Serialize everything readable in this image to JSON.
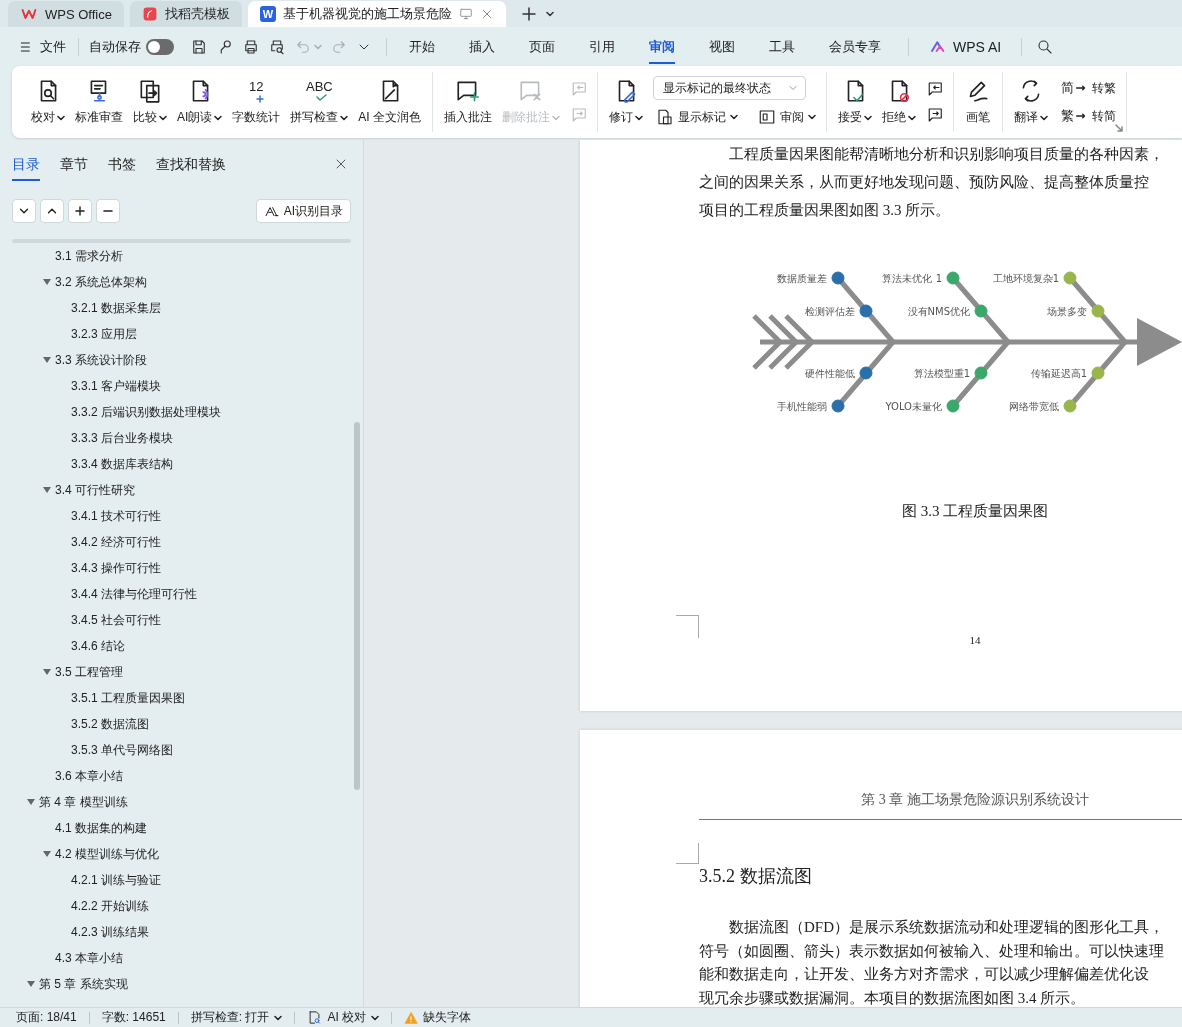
{
  "window_tabs": [
    {
      "kind": "home",
      "label": "WPS Office",
      "selected": false
    },
    {
      "kind": "template",
      "label": "找稻壳模板",
      "selected": false
    },
    {
      "kind": "document",
      "badge": "W",
      "label": "基于机器视觉的施工场景危险",
      "selected": true
    }
  ],
  "menu": {
    "file": "文件",
    "autosave": {
      "label": "自动保存",
      "on": false
    },
    "tabs": [
      {
        "label": "开始",
        "selected": false
      },
      {
        "label": "插入",
        "selected": false
      },
      {
        "label": "页面",
        "selected": false
      },
      {
        "label": "引用",
        "selected": false
      },
      {
        "label": "审阅",
        "selected": true
      },
      {
        "label": "视图",
        "selected": false
      },
      {
        "label": "工具",
        "selected": false
      },
      {
        "label": "会员专享",
        "selected": false
      }
    ],
    "ai": "WPS AI"
  },
  "ribbon": {
    "groups": [
      {
        "items": [
          {
            "kind": "large",
            "label": "校对",
            "dropdown": true,
            "disabled": false
          },
          {
            "kind": "large",
            "label": "标准审查",
            "dropdown": false,
            "disabled": false
          },
          {
            "kind": "large",
            "label": "比较",
            "dropdown": true,
            "disabled": false
          },
          {
            "kind": "large",
            "label": "AI朗读",
            "dropdown": true,
            "disabled": false
          },
          {
            "kind": "large",
            "glyph": "12",
            "label": "字数统计",
            "dropdown": false,
            "disabled": false
          },
          {
            "kind": "large",
            "glyph": "ABC",
            "label": "拼写检查",
            "dropdown": true,
            "disabled": false
          },
          {
            "kind": "large",
            "label": "AI 全文润色",
            "dropdown": false,
            "disabled": false
          }
        ]
      },
      {
        "items": [
          {
            "kind": "large",
            "label": "插入批注",
            "dropdown": false,
            "disabled": false
          },
          {
            "kind": "large",
            "label": "删除批注",
            "dropdown": true,
            "disabled": true
          },
          {
            "kind": "stack",
            "items": [
              {
                "kind": "icon",
                "disabled": true
              },
              {
                "kind": "icon",
                "disabled": true
              }
            ]
          }
        ]
      },
      {
        "items": [
          {
            "kind": "large",
            "label": "修订",
            "dropdown": true,
            "disabled": false
          },
          {
            "kind": "stack",
            "items": [
              {
                "kind": "select",
                "value": "显示标记的最终状态"
              },
              {
                "kind": "row",
                "items": [
                  {
                    "kind": "small",
                    "label": "显示标记",
                    "dropdown": true,
                    "disabled": false
                  },
                  {
                    "kind": "small",
                    "label": "审阅",
                    "dropdown": true,
                    "disabled": false
                  }
                ]
              }
            ]
          }
        ]
      },
      {
        "items": [
          {
            "kind": "large",
            "label": "接受",
            "dropdown": true,
            "disabled": false
          },
          {
            "kind": "large",
            "label": "拒绝",
            "dropdown": true,
            "disabled": false
          },
          {
            "kind": "stack",
            "items": [
              {
                "kind": "icon",
                "disabled": false
              },
              {
                "kind": "icon",
                "disabled": false
              }
            ]
          }
        ]
      },
      {
        "items": [
          {
            "kind": "large",
            "label": "画笔",
            "dropdown": false,
            "disabled": false
          }
        ]
      },
      {
        "items": [
          {
            "kind": "large",
            "label": "翻译",
            "dropdown": true,
            "disabled": false
          },
          {
            "kind": "stack",
            "items": [
              {
                "kind": "small",
                "glyph": "简",
                "label": "转繁",
                "dropdown": false,
                "disabled": false
              },
              {
                "kind": "small",
                "glyph": "繁",
                "label": "转简",
                "dropdown": false,
                "disabled": false
              }
            ]
          }
        ]
      }
    ]
  },
  "nav": {
    "tabs": [
      {
        "label": "目录",
        "selected": true
      },
      {
        "label": "章节",
        "selected": false
      },
      {
        "label": "书签",
        "selected": false
      },
      {
        "label": "查找和替换",
        "selected": false
      }
    ],
    "ai_button": "AI识别目录",
    "toc": [
      {
        "children": [
          {
            "label": "3.1 需求分析"
          },
          {
            "label": "3.2 系统总体架构",
            "expanded": true,
            "children": [
              {
                "label": "3.2.1 数据采集层"
              },
              {
                "label": "3.2.3 应用层"
              }
            ]
          },
          {
            "label": "3.3 系统设计阶段",
            "expanded": true,
            "children": [
              {
                "label": "3.3.1 客户端模块"
              },
              {
                "label": "3.3.2 后端识别数据处理模块"
              },
              {
                "label": "3.3.3 后台业务模块"
              },
              {
                "label": "3.3.4 数据库表结构"
              }
            ]
          },
          {
            "label": "3.4 可行性研究",
            "expanded": true,
            "children": [
              {
                "label": "3.4.1 技术可行性"
              },
              {
                "label": "3.4.2 经济可行性"
              },
              {
                "label": "3.4.3 操作可行性"
              },
              {
                "label": "3.4.4 法律与伦理可行性"
              },
              {
                "label": "3.4.5 社会可行性"
              },
              {
                "label": "3.4.6 结论"
              }
            ]
          },
          {
            "label": "3.5 工程管理",
            "expanded": true,
            "children": [
              {
                "label": "3.5.1 工程质量因果图"
              },
              {
                "label": "3.5.2 数据流图"
              },
              {
                "label": "3.5.3 单代号网络图"
              }
            ]
          },
          {
            "label": "3.6 本章小结"
          }
        ]
      },
      {
        "label": "第 4 章 模型训练",
        "expanded": true,
        "children": [
          {
            "label": "4.1 数据集的构建"
          },
          {
            "label": "4.2 模型训练与优化",
            "expanded": true,
            "children": [
              {
                "label": "4.2.1 训练与验证"
              },
              {
                "label": "4.2.2 开始训练"
              },
              {
                "label": "4.2.3 训练结果"
              }
            ]
          },
          {
            "label": "4.3 本章小结"
          }
        ]
      },
      {
        "label": "第 5 章 系统实现",
        "expanded": true
      }
    ]
  },
  "document": {
    "page_1": {
      "paragraph": [
        "工程质量因果图能帮清晰地分析和识别影响项目质量的各种因素，",
        "之间的因果关系，从而更好地发现问题、预防风险、提高整体质量控",
        "项目的工程质量因果图如图 3.3 所示。"
      ],
      "figure": {
        "groups": [
          {
            "color": "#2a6fa8",
            "top": [
              "数据质量差",
              "检测评估差"
            ],
            "bottom": [
              "硬件性能低",
              "手机性能弱"
            ]
          },
          {
            "color": "#3aa86a",
            "top": [
              "算法未优化 1",
              "没有NMS优化"
            ],
            "bottom": [
              "算法模型重1",
              "YOLO未量化"
            ]
          },
          {
            "color": "#9ab54a",
            "top": [
              "工地环境复杂1",
              "场景多变"
            ],
            "bottom": [
              "传输延迟高1",
              "网络带宽低"
            ]
          }
        ]
      },
      "caption": "图 3.3 工程质量因果图",
      "page_number": "14"
    },
    "page_2": {
      "header": "第 3 章 施工场景危险源识别系统设计",
      "heading": "3.5.2 数据流图",
      "paragraph": [
        "数据流图（DFD）是展示系统数据流动和处理逻辑的图形化工具，",
        "符号（如圆圈、箭头）表示数据如何被输入、处理和输出。可以快速理",
        "能和数据走向，让开发、业务方对齐需求，可以减少理解偏差优化设",
        "现冗余步骤或数据漏洞。本项目的数据流图如图 3.4 所示。"
      ]
    }
  },
  "status_bar": {
    "page": "页面: 18/41",
    "words": "字数: 14651",
    "spellcheck": "拼写检查: 打开",
    "ai_check": "AI 校对",
    "missing_fonts": "缺失字体"
  }
}
